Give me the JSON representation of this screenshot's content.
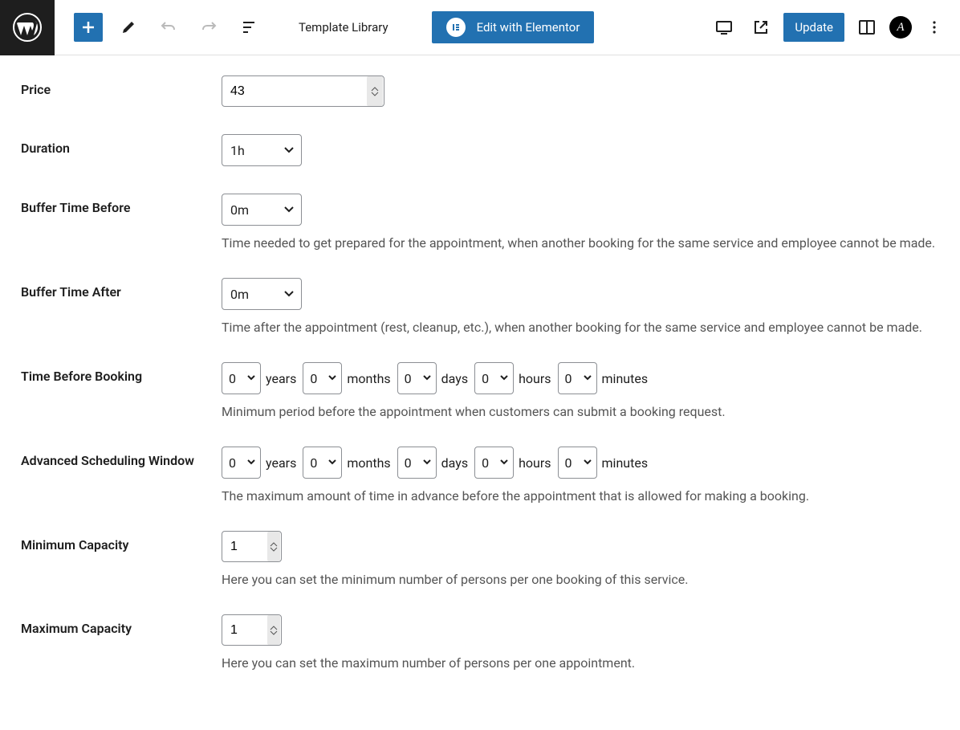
{
  "topbar": {
    "breadcrumb": "Template Library",
    "elementor_label": "Edit with Elementor",
    "update_label": "Update"
  },
  "fields": {
    "price": {
      "label": "Price",
      "value": "43"
    },
    "duration": {
      "label": "Duration",
      "value": "1h"
    },
    "buffer_before": {
      "label": "Buffer Time Before",
      "value": "0m",
      "help": "Time needed to get prepared for the appointment, when another booking for the same service and employee cannot be made."
    },
    "buffer_after": {
      "label": "Buffer Time After",
      "value": "0m",
      "help": "Time after the appointment (rest, cleanup, etc.), when another booking for the same service and employee cannot be made."
    },
    "time_before": {
      "label": "Time Before Booking",
      "years": "0",
      "months": "0",
      "days": "0",
      "hours": "0",
      "minutes": "0",
      "help": "Minimum period before the appointment when customers can submit a booking request."
    },
    "adv_window": {
      "label": "Advanced Scheduling Window",
      "years": "0",
      "months": "0",
      "days": "0",
      "hours": "0",
      "minutes": "0",
      "help": "The maximum amount of time in advance before the appointment that is allowed for making a booking."
    },
    "min_cap": {
      "label": "Minimum Capacity",
      "value": "1",
      "help": "Here you can set the minimum number of persons per one booking of this service."
    },
    "max_cap": {
      "label": "Maximum Capacity",
      "value": "1",
      "help": "Here you can set the maximum number of persons per one appointment."
    }
  },
  "units": {
    "years": "years",
    "months": "months",
    "days": "days",
    "hours": "hours",
    "minutes": "minutes"
  }
}
